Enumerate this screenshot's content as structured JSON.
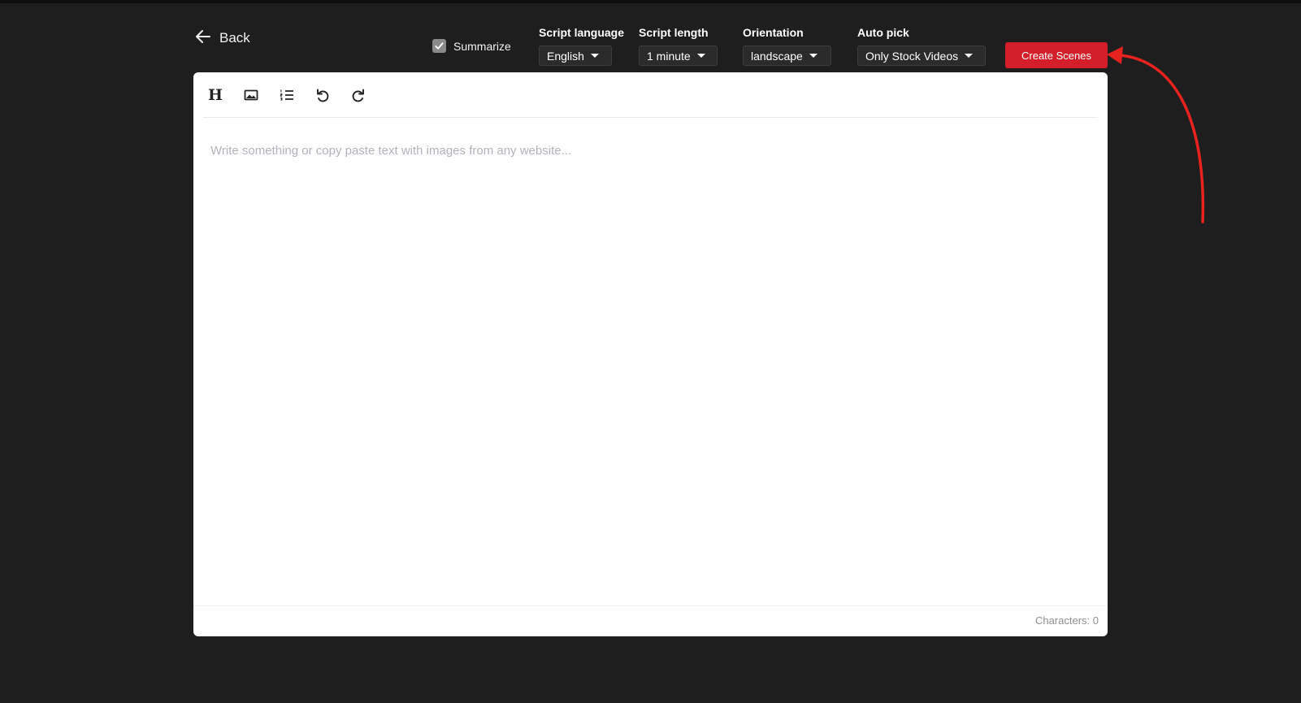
{
  "header": {
    "back_label": "Back"
  },
  "options": {
    "summarize_label": "Summarize",
    "summarize_checked": true,
    "script_language": {
      "label": "Script language",
      "value": "English"
    },
    "script_length": {
      "label": "Script length",
      "value": "1 minute"
    },
    "orientation": {
      "label": "Orientation",
      "value": "landscape"
    },
    "auto_pick": {
      "label": "Auto pick",
      "value": "Only Stock Videos"
    }
  },
  "actions": {
    "create_label": "Create Scenes"
  },
  "editor": {
    "toolbar": [
      "heading-icon",
      "image-icon",
      "numbered-list-icon",
      "undo-icon",
      "redo-icon"
    ],
    "heading_glyph": "H",
    "placeholder": "Write something or copy paste text with images from any website...",
    "characters_label": "Characters: 0"
  },
  "colors": {
    "background": "#1e1e1e",
    "accent": "#d41f2a",
    "annotation_arrow": "#e8231f"
  }
}
